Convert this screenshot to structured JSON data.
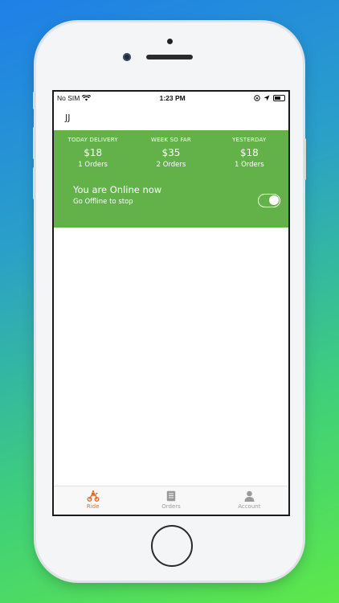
{
  "status_bar": {
    "carrier": "No SIM",
    "time": "1:23 PM"
  },
  "header": {
    "title": "JJ"
  },
  "stats": [
    {
      "label": "TODAY DELIVERY",
      "amount": "$18",
      "orders": "1 Orders"
    },
    {
      "label": "WEEK SO FAR",
      "amount": "$35",
      "orders": "2 Orders"
    },
    {
      "label": "YESTERDAY",
      "amount": "$18",
      "orders": "1 Orders"
    }
  ],
  "online": {
    "title": "You are Online now",
    "subtitle": "Go Offline to stop",
    "toggle_on": true
  },
  "tabs": [
    {
      "label": "Ride",
      "icon": "scooter-icon",
      "active": true
    },
    {
      "label": "Orders",
      "icon": "document-icon",
      "active": false
    },
    {
      "label": "Account",
      "icon": "person-icon",
      "active": false
    }
  ],
  "colors": {
    "accent": "#62b149",
    "active_tab": "#e86a2a",
    "inactive_tab": "#9a9a9a"
  }
}
